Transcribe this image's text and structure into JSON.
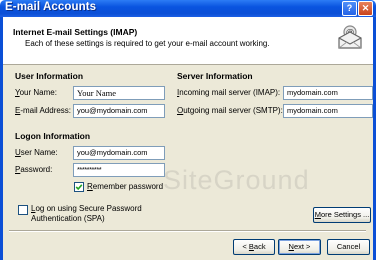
{
  "window": {
    "title": "E-mail Accounts",
    "help_glyph": "?",
    "close_glyph": "✕"
  },
  "header": {
    "title": "Internet E-mail Settings (IMAP)",
    "subtitle": "Each of these settings is required to get your e-mail account working."
  },
  "user_info": {
    "section_label": "User Information",
    "name_label": "Your Name:",
    "name_value": "Your Name",
    "email_label": "E-mail Address:",
    "email_value": "you@mydomain.com"
  },
  "server_info": {
    "section_label": "Server Information",
    "incoming_label": "Incoming mail server (IMAP):",
    "incoming_value": "mydomain.com",
    "outgoing_label": "Outgoing mail server (SMTP):",
    "outgoing_value": "mydomain.com"
  },
  "logon_info": {
    "section_label": "Logon Information",
    "username_label": "User Name:",
    "username_value": "you@mydomain.com",
    "password_label": "Password:",
    "password_value": "**********",
    "remember_label": "Remember password",
    "remember_checked": true
  },
  "spa": {
    "label_line1": "Log on using Secure Password",
    "label_line2": "Authentication (SPA)",
    "checked": false
  },
  "buttons": {
    "more_settings": "More Settings ...",
    "back": "< Back",
    "next": "Next >",
    "cancel": "Cancel"
  },
  "watermark": "SiteGround",
  "icons": {
    "header_icon": "envelope-at-icon",
    "check_icon": "checkmark-icon"
  }
}
